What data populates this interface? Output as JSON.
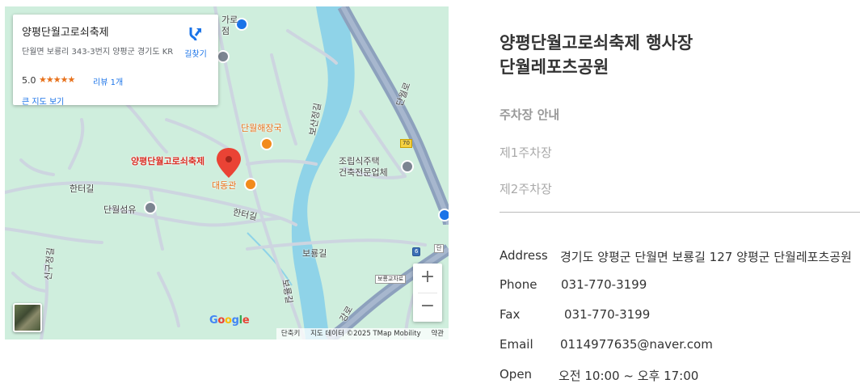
{
  "map": {
    "info_card": {
      "title": "양평단월고로쇠축제",
      "address": "단월면 보룡리 343-3번지 양평군 경기도 KR",
      "rating": "5.0",
      "stars": "★★★★★",
      "reviews": "리뷰 1개",
      "large_map_link": "큰 지도 보기",
      "directions_label": "길찾기"
    },
    "labels": {
      "marker": "양평단월고로쇠축제",
      "restaurant1": "단월해장국",
      "restaurant2": "대동관",
      "prefab": "조립식주택\n건축전문업체",
      "textile": "단월섬유",
      "road_hanteo1": "한터길",
      "road_hanteo2": "한터길",
      "road_boryong": "보룡길",
      "road_boryong2": "보룡길",
      "road_bosan": "보산정길",
      "road_sinkwon": "신구정길",
      "road_danwol": "단월로",
      "road_garo": "가로",
      "road_jeom": "점",
      "bridge": "보룡교차로",
      "route70": "70",
      "route6": "6",
      "road_gang": "강로",
      "top_right_sign": "단"
    },
    "zoom_in": "+",
    "zoom_out": "−",
    "google_logo": "Google",
    "attribution": {
      "shortcuts": "단축키",
      "data": "지도 데이터 ©2025 TMap Mobility",
      "terms": "약관"
    },
    "colors": {
      "land": "#cfeedd",
      "water": "#8fd3e8",
      "road": "#cdd5e0",
      "highway": "#8da1bd",
      "marker": "#ea4335"
    }
  },
  "venue": {
    "title_line1": "양평단월고로쇠축제 행사장",
    "title_line2": "단월레포츠공원"
  },
  "parking": {
    "heading": "주차장 안내",
    "items": [
      "제1주차장",
      "제2주차장"
    ]
  },
  "contact": {
    "address_label": "Address",
    "address_value": "경기도 양평군 단월면 보룡길 127 양평군 단월레포츠공원",
    "phone_label": "Phone",
    "phone_value": "031-770-3199",
    "fax_label": "Fax",
    "fax_value": "031-770-3199",
    "email_label": "Email",
    "email_value": "0114977635@naver.com",
    "open_label": "Open",
    "open_value": "오전 10:00 ~ 오후 17:00"
  }
}
